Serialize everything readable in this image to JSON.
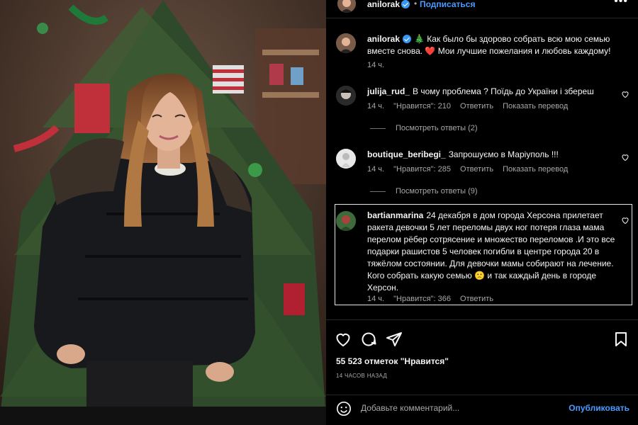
{
  "post_header": {
    "username": "anilorak",
    "separator": "•",
    "follow_label": "Подписаться",
    "more_label": "•••"
  },
  "caption": {
    "username": "anilorak",
    "text": "🎄 Как было бы здорово собрать всю мою семью вместе снова. ❤️ Мои лучшие пожелания и любовь каждому!",
    "time": "14 ч."
  },
  "comments": [
    {
      "username": "julija_rud_",
      "text": "В чому проблема ? Поїдь до України і збереш",
      "time": "14 ч.",
      "likes": "\"Нравится\": 210",
      "reply": "Ответить",
      "translate": "Показать перевод",
      "view_replies": "Посмотреть ответы (2)"
    },
    {
      "username": "boutique_beribegi_",
      "text": "Запрошуємо в Маріуполь !!!",
      "time": "14 ч.",
      "likes": "\"Нравится\": 285",
      "reply": "Ответить",
      "translate": "Показать перевод",
      "view_replies": "Посмотреть ответы (9)"
    },
    {
      "username": "bartianmarina",
      "text": "24 декабря в дом города Херсона прилетает ракета девочки 5 лет переломы двух ног потеря глаза мама перелом рёбер сотрясение и множество переломов .И это все подарки рашистов 5 человек погибли в центре города 20 в тяжёлом состоянии. Для девочки мамы собирают на лечение. Кого собрать какую семью 🙁 и так каждый день в городе Херсон.",
      "time": "14 ч.",
      "likes": "\"Нравится\": 366",
      "reply": "Ответить"
    }
  ],
  "actions": {
    "likes_count": "55 523 отметок \"Нравится\"",
    "time_ago": "14 ЧАСОВ НАЗАД"
  },
  "add_comment": {
    "placeholder": "Добавьте комментарий...",
    "publish_label": "Опубликовать"
  },
  "icons": {
    "like": "heart-icon",
    "comment": "comment-icon",
    "share": "share-icon",
    "save": "bookmark-icon",
    "emoji": "emoji-icon",
    "verified": "verified-badge-icon"
  },
  "colors": {
    "background": "#000000",
    "text": "#f5f5f5",
    "muted": "#a8a8a8",
    "link": "#4a9bff",
    "verified": "#3897f0"
  }
}
